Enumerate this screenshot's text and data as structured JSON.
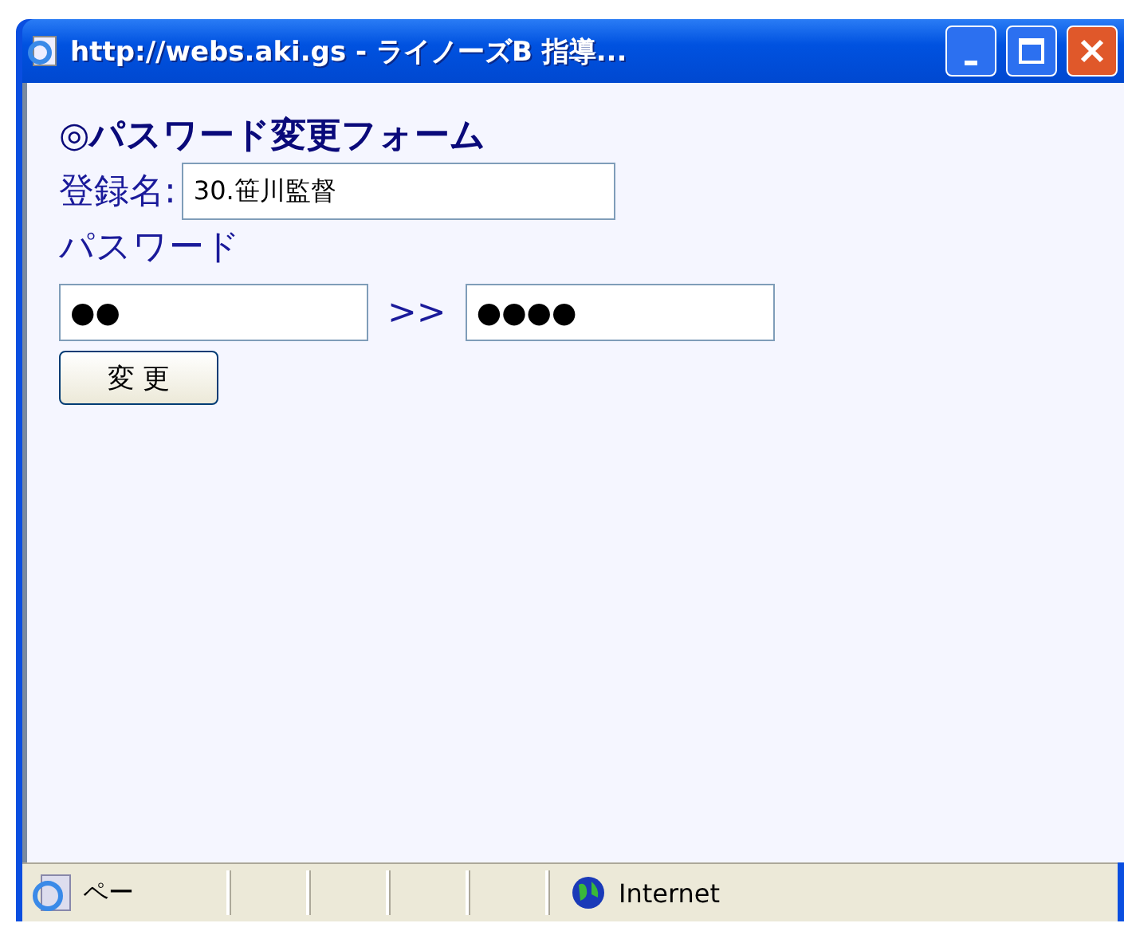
{
  "window": {
    "title": "http://webs.aki.gs - ライノーズB 指導..."
  },
  "form": {
    "heading": "◎パスワード変更フォーム",
    "name_label": "登録名:",
    "name_value": "30.笹川監督",
    "password_label": "パスワード",
    "old_password": "●●",
    "arrow": ">>",
    "new_password": "●●●●",
    "submit": "変 更"
  },
  "status_bar": {
    "text": "ペー",
    "zone": "Internet"
  }
}
